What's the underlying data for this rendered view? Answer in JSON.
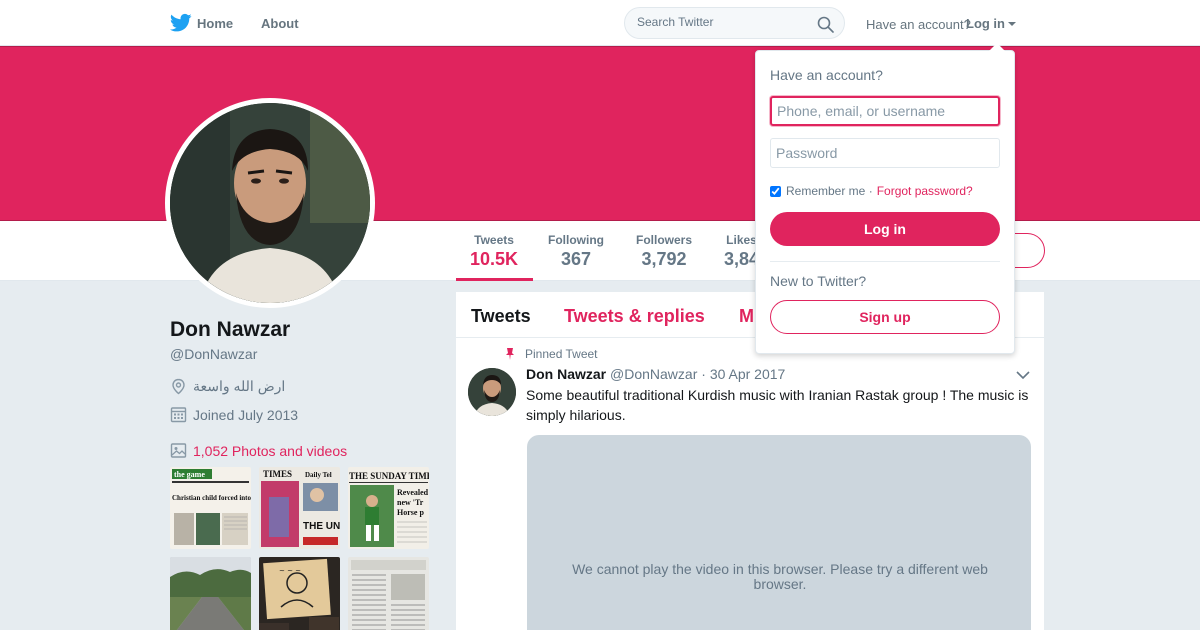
{
  "nav": {
    "home_label": "Home",
    "about_label": "About",
    "search_placeholder": "Search Twitter",
    "have_account": "Have an account?",
    "login_label": "Log in"
  },
  "colors": {
    "accent": "#e0245e",
    "banner": "#e0245e",
    "text_secondary": "#657786"
  },
  "profile": {
    "name": "Don Nawzar",
    "handle": "@DonNawzar",
    "location": "ارض الله واسعة",
    "joined": "Joined July 2013",
    "photos_link": "1,052 Photos and videos"
  },
  "stats": [
    {
      "label": "Tweets",
      "value": "10.5K"
    },
    {
      "label": "Following",
      "value": "367"
    },
    {
      "label": "Followers",
      "value": "3,792"
    },
    {
      "label": "Likes",
      "value": "3,84"
    }
  ],
  "thumbnails": [
    {
      "name": "newspaper-the-game",
      "headline": "Christian child forced into Muslim foster care"
    },
    {
      "name": "newspaper-times-daily-telegraph",
      "headline": "THE UN MUFTI"
    },
    {
      "name": "newspaper-sunday-times",
      "headline": "THE SUNDAY TIMES"
    },
    {
      "name": "road-landscape",
      "headline": ""
    },
    {
      "name": "protest-sign",
      "headline": ""
    },
    {
      "name": "newspaper-clipping",
      "headline": ""
    }
  ],
  "timeline": {
    "tabs": [
      "Tweets",
      "Tweets & replies",
      "M"
    ],
    "pinned_label": "Pinned Tweet",
    "tweet": {
      "author": "Don Nawzar",
      "handle": "@DonNawzar",
      "date": "· 30 Apr 2017",
      "text": "Some beautiful traditional Kurdish music with Iranian Rastak group ! The music is simply hilarious.",
      "video_message": "We cannot play the video in this browser. Please try a different web browser."
    }
  },
  "login_dropdown": {
    "title": "Have an account?",
    "username_placeholder": "Phone, email, or username",
    "password_placeholder": "Password",
    "remember_label": "Remember me ·",
    "remember_checked": true,
    "forgot_label": "Forgot password?",
    "login_button": "Log in",
    "new_label": "New to Twitter?",
    "signup_button": "Sign up"
  }
}
